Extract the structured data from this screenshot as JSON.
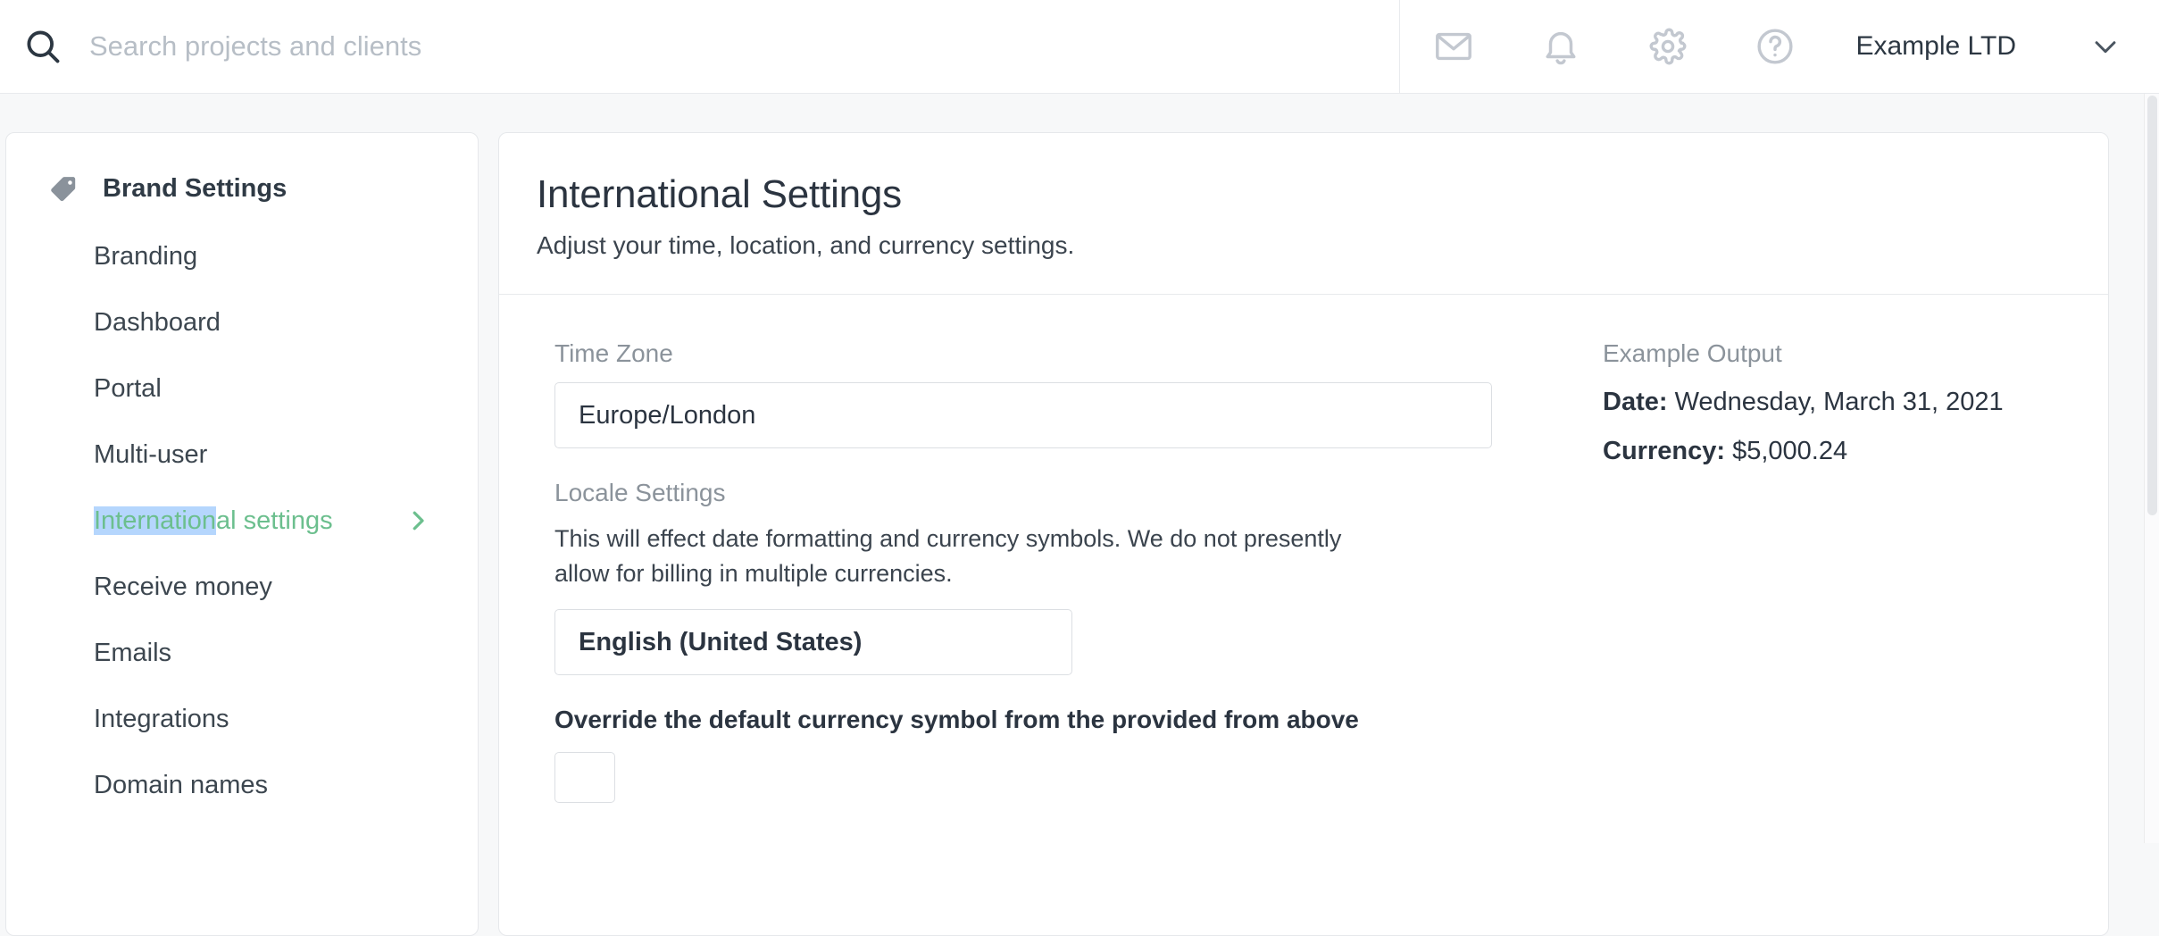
{
  "header": {
    "search": {
      "placeholder": "Search projects and clients",
      "value": "",
      "icon": "search-icon"
    },
    "icons": [
      {
        "name": "mail-icon",
        "label": "Messages"
      },
      {
        "name": "bell-icon",
        "label": "Notifications"
      },
      {
        "name": "gear-icon",
        "label": "Settings"
      },
      {
        "name": "help-icon",
        "label": "Help"
      }
    ],
    "org_name": "Example LTD",
    "chevron": "chevron-down-icon"
  },
  "sidebar": {
    "heading": "Brand Settings",
    "heading_icon": "tag-icon",
    "items": [
      {
        "label": "Branding",
        "active": false
      },
      {
        "label": "Dashboard",
        "active": false
      },
      {
        "label": "Portal",
        "active": false
      },
      {
        "label": "Multi-user",
        "active": false
      },
      {
        "label": "International settings",
        "active": true,
        "selected_text": "Internation",
        "rest_text": "al settings",
        "chevron": "chevron-right-icon"
      },
      {
        "label": "Receive money",
        "active": false
      },
      {
        "label": "Emails",
        "active": false
      },
      {
        "label": "Integrations",
        "active": false
      },
      {
        "label": "Domain names",
        "active": false
      }
    ]
  },
  "main": {
    "title": "International Settings",
    "subtitle": "Adjust your time, location, and currency settings.",
    "timezone": {
      "label": "Time Zone",
      "value": "Europe/London"
    },
    "locale": {
      "label": "Locale Settings",
      "description": "This will effect date formatting and currency symbols. We do not presently allow for billing in multiple currencies.",
      "value": "English (United States)"
    },
    "override": {
      "label": "Override the default currency symbol from the provided from above",
      "value": "",
      "placeholder": ""
    },
    "example_output": {
      "label": "Example Output",
      "date_key": "Date:",
      "date_value": "Wednesday, March 31, 2021",
      "currency_key": "Currency:",
      "currency_value": "$5,000.24"
    }
  },
  "colors": {
    "accent_green": "#6cbf8e",
    "selection_blue": "#b5d6fd",
    "text_dark": "#2b3440",
    "text_muted": "#8b939b",
    "border": "#e6e8eb"
  }
}
